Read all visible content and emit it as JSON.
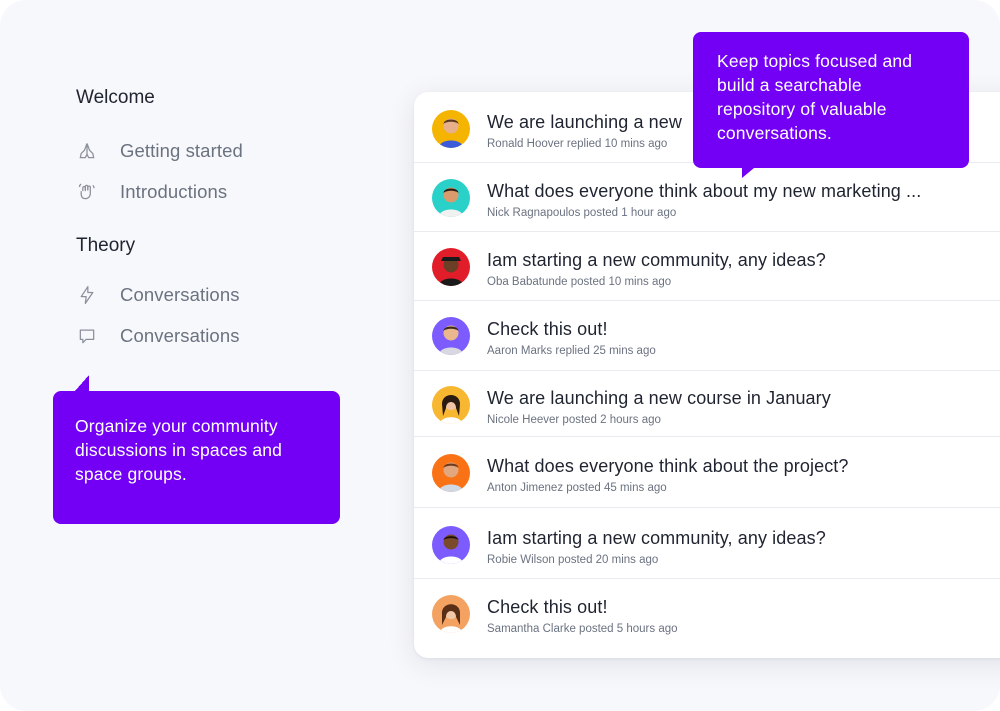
{
  "sidebar": {
    "sections": [
      {
        "title": "Welcome",
        "items": [
          {
            "label": "Getting started",
            "icon": "praying-hands-icon"
          },
          {
            "label": "Introductions",
            "icon": "waving-hand-icon"
          }
        ]
      },
      {
        "title": "Theory",
        "items": [
          {
            "label": "Conversations",
            "icon": "lightning-icon"
          },
          {
            "label": "Conversations",
            "icon": "chat-bubble-icon"
          }
        ]
      }
    ]
  },
  "tooltips": {
    "left": "Organize your community discussions in spaces and space groups.",
    "right": "Keep topics focused and build a searchable repository of valuable conversations."
  },
  "feed": {
    "posts": [
      {
        "title": "We are launching a new",
        "meta": "Ronald Hoover replied 10 mins ago",
        "avatar_bg": "#f5b400"
      },
      {
        "title": "What does everyone think about my new marketing ...",
        "meta": "Nick Ragnapoulos posted 1 hour ago",
        "avatar_bg": "#2ad1c9"
      },
      {
        "title": "Iam starting a new community, any ideas?",
        "meta": "Oba Babatunde posted 10 mins ago",
        "avatar_bg": "#e11d2a"
      },
      {
        "title": "Check this out!",
        "meta": "Aaron Marks replied 25 mins ago",
        "avatar_bg": "#7c5cff"
      },
      {
        "title": "We are launching a new course in January",
        "meta": "Nicole Heever posted 2 hours ago",
        "avatar_bg": "#f7b731"
      },
      {
        "title": "What does everyone think about the project?",
        "meta": "Anton Jimenez posted 45 mins ago",
        "avatar_bg": "#f97316"
      },
      {
        "title": "Iam starting a new community, any ideas?",
        "meta": "Robie Wilson posted 20 mins ago",
        "avatar_bg": "#7c5cff"
      },
      {
        "title": "Check this out!",
        "meta": "Samantha Clarke posted 5 hours ago",
        "avatar_bg": "#f4a261"
      }
    ]
  },
  "colors": {
    "accent": "#7300f5",
    "background": "#f7f8fb"
  }
}
